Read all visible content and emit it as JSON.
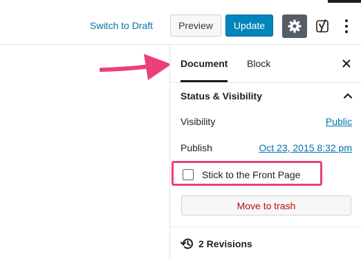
{
  "toolbar": {
    "switch_to_draft": "Switch to Draft",
    "preview": "Preview",
    "update": "Update",
    "settings_icon": "gear-icon",
    "yoast_icon": "yoast-icon",
    "more_icon": "more-vertical-icon"
  },
  "sidebar": {
    "tabs": [
      {
        "label": "Document",
        "active": true
      },
      {
        "label": "Block",
        "active": false
      }
    ],
    "close_icon": "close-icon",
    "panel": {
      "title": "Status & Visibility",
      "expanded": true,
      "visibility_label": "Visibility",
      "visibility_value": "Public",
      "publish_label": "Publish",
      "publish_value": "Oct 23, 2015 8:32 pm",
      "stick_label": "Stick to the Front Page",
      "stick_checked": false,
      "trash_label": "Move to trash"
    },
    "revisions": {
      "icon": "history-icon",
      "label": "2 Revisions"
    }
  },
  "colors": {
    "accent": "#0085ba",
    "link": "#0073aa",
    "highlight": "#ec3f7a",
    "danger": "#bc0b0b",
    "settings_bg": "#555d66"
  }
}
